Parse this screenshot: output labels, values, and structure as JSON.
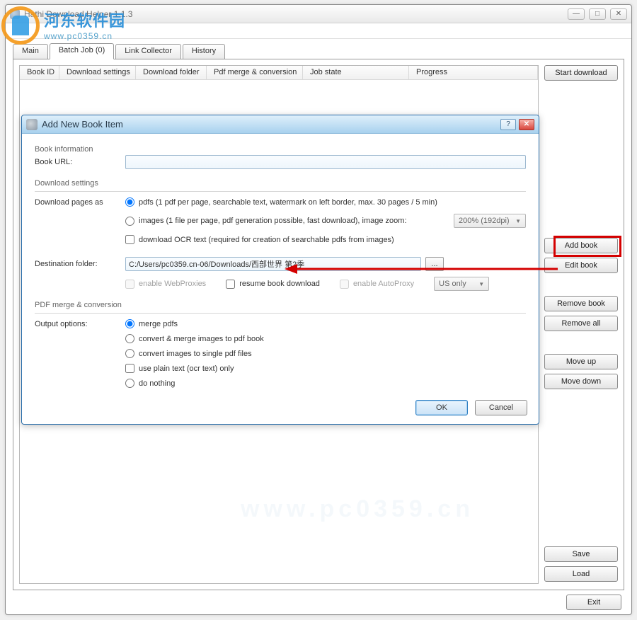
{
  "window": {
    "title": "Hathi Download Helper 1.1.3",
    "controls": {
      "min": "—",
      "max": "□",
      "close": "✕"
    }
  },
  "menubar": {
    "label": ""
  },
  "tabs": [
    {
      "label": "Main"
    },
    {
      "label": "Batch Job (0)"
    },
    {
      "label": "Link Collector"
    },
    {
      "label": "History"
    }
  ],
  "columns": [
    "Book ID",
    "Download settings",
    "Download folder",
    "Pdf merge & conversion",
    "Job state",
    "Progress"
  ],
  "side": {
    "start": "Start download",
    "add": "Add book",
    "edit": "Edit book",
    "remove": "Remove book",
    "remove_all": "Remove all",
    "move_up": "Move up",
    "move_down": "Move down",
    "save": "Save",
    "load": "Load"
  },
  "bottom": {
    "exit": "Exit"
  },
  "dialog": {
    "title": "Add New Book Item",
    "help": "?",
    "close": "✕",
    "section_info": "Book information",
    "book_url_label": "Book URL:",
    "book_url_value": "",
    "section_dl": "Download settings",
    "dl_pages_label": "Download pages as",
    "opt_pdfs": "pdfs (1 pdf per page, searchable text,  watermark on left border,  max. 30 pages / 5 min)",
    "opt_images": "images (1 file per page, pdf generation possible, fast download), image zoom:",
    "zoom_value": "200% (192dpi)",
    "opt_ocr": "download OCR text (required for creation of searchable pdfs from images)",
    "dest_label": "Destination folder:",
    "dest_value": "C:/Users/pc0359.cn-06/Downloads/西部世界 第2季",
    "browse": "...",
    "enable_proxies": "enable WebProxies",
    "resume": "resume book download",
    "autoproxy": "enable AutoProxy",
    "autoproxy_value": "US only",
    "section_pdf": "PDF merge & conversion",
    "out_label": "Output options:",
    "out_merge": "merge pdfs",
    "out_conv1": "convert & merge images to pdf book",
    "out_conv2": "convert images to single pdf files",
    "out_plain": "use plain text (ocr text) only",
    "out_nothing": "do nothing",
    "ok": "OK",
    "cancel": "Cancel"
  },
  "watermark": {
    "cn": "河东软件园",
    "url": "www.pc0359.cn"
  }
}
